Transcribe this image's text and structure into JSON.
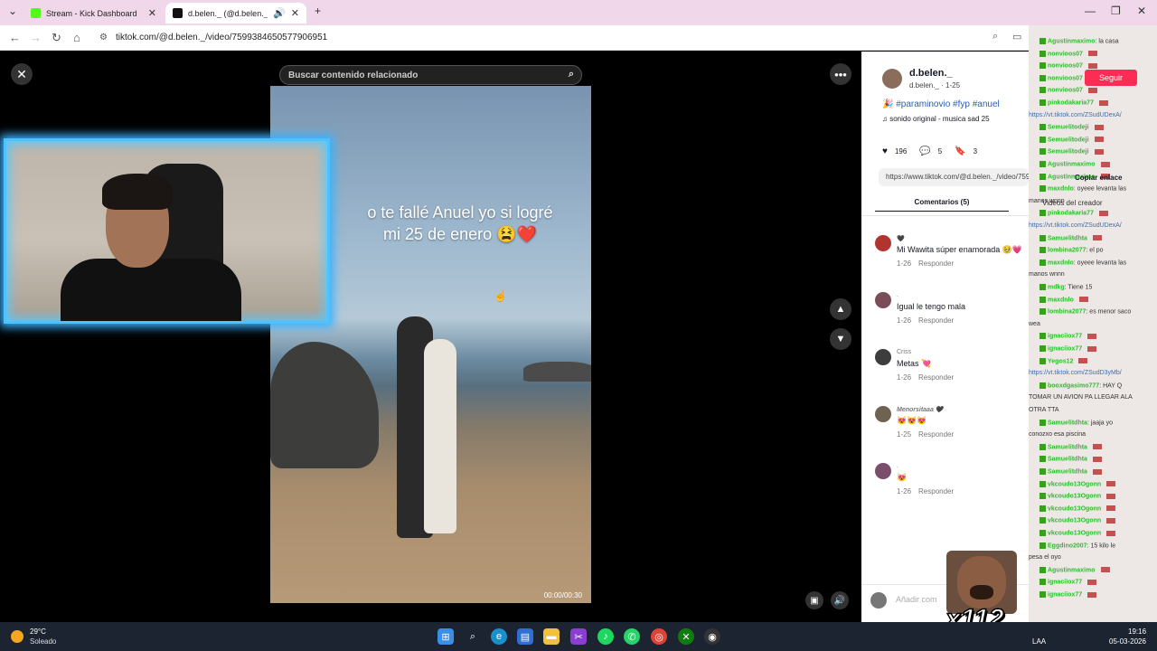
{
  "browser": {
    "tabs": [
      {
        "title": "Stream - Kick Dashboard",
        "favicon_color": "#53fc18"
      },
      {
        "title": "d.belen._ (@d.belen._) | TikT",
        "favicon_color": "#111111"
      }
    ],
    "url": "tiktok.com/@d.belen._/video/7599384650577906951"
  },
  "viewer": {
    "search_placeholder": "Buscar contenido relacionado",
    "caption_line1": "o te fallé Anuel yo si logré",
    "caption_line2": "mi  25 de enero 😫❤️",
    "timestamp": "00:00/00:30"
  },
  "post": {
    "author": "d.belen._",
    "author_sub": "d.belen._ · 1-25",
    "description": "🎉 #paraminovio #fyp #anuel",
    "music": "sonido original - musica sad 25",
    "likes": "196",
    "comments_count": "5",
    "saves": "3",
    "link": "https://www.tiktok.com/@d.belen._/video/759938...",
    "comments_tab": "Comentarios (5)",
    "add_comment_placeholder": "Añadir com"
  },
  "comments": [
    {
      "name": "🖤",
      "text": "Mi Wawita súper enamorada 🥹💗",
      "date": "1-26",
      "reply": "Responder"
    },
    {
      "name": ".",
      "text": "Igual le tengo mala",
      "date": "1-26",
      "reply": "Responder"
    },
    {
      "name": "Criss",
      "text": "Metas 💘",
      "date": "1-26",
      "reply": "Responder"
    },
    {
      "name": "Menorsitaaa 🖤",
      "text": "😻😻😻",
      "date": "1-25",
      "reply": "Responder"
    },
    {
      "name": ".",
      "text": "😻",
      "date": "1-26",
      "reply": "Responder"
    }
  ],
  "overlay": {
    "follow_label": "Seguir",
    "copy_link_label": "Copiar enlace",
    "creator_videos_label": "Videos del creador",
    "emote_count": "x112"
  },
  "chat": [
    {
      "user": "Agustinmaximo",
      "msg": ": la casa"
    },
    {
      "user": "nonvioos07",
      "msg": ""
    },
    {
      "user": "nonvioos07",
      "msg": ""
    },
    {
      "user": "nonvioos07",
      "msg": ""
    },
    {
      "user": "nonvioos07",
      "msg": ""
    },
    {
      "user": "pinkodakaria77",
      "msg": ""
    },
    {
      "user": "",
      "msg": "https://vt.tiktok.com/ZSudUDexA/"
    },
    {
      "user": "Semuelitodeji",
      "msg": ""
    },
    {
      "user": "Semuelitodeji",
      "msg": ""
    },
    {
      "user": "Semuelitodeji",
      "msg": ""
    },
    {
      "user": "Agustinmaximo",
      "msg": ""
    },
    {
      "user": "Agustinmaximo",
      "msg": ""
    },
    {
      "user": "maxdnlo",
      "msg": ": oyeee levanta las"
    },
    {
      "user": "",
      "msg": "manos wnnn"
    },
    {
      "user": "pinkodakaria77",
      "msg": ""
    },
    {
      "user": "",
      "msg": "https://vt.tiktok.com/ZSudUDexA/"
    },
    {
      "user": "Samuelitdhta",
      "msg": ""
    },
    {
      "user": "lombina2077",
      "msg": ": el po"
    },
    {
      "user": "maxdnlo",
      "msg": ": oyeee levanta las"
    },
    {
      "user": "",
      "msg": "manos wnnn"
    },
    {
      "user": "mdkg",
      "msg": ": Tiene 15"
    },
    {
      "user": "maxdnlo",
      "msg": ""
    },
    {
      "user": "lombina2077",
      "msg": ": es menor saco"
    },
    {
      "user": "",
      "msg": "wea"
    },
    {
      "user": "ignaciiox77",
      "msg": ""
    },
    {
      "user": "ignaciiox77",
      "msg": ""
    },
    {
      "user": "Yegos12",
      "msg": ""
    },
    {
      "user": "",
      "msg": "https://vt.tiktok.com/ZSudD3yMb/"
    },
    {
      "user": "booxdgasimo777",
      "msg": ": HAY Q"
    },
    {
      "user": "",
      "msg": "TOMAR UN AVION PA LLEGAR ALA"
    },
    {
      "user": "",
      "msg": "OTRA TTA"
    },
    {
      "user": "Samuelitdhta",
      "msg": ": jaaja yo"
    },
    {
      "user": "",
      "msg": "conozxo esa piscina"
    },
    {
      "user": "Samuelitdhta",
      "msg": ""
    },
    {
      "user": "Samuelitdhta",
      "msg": ""
    },
    {
      "user": "Samuelitdhta",
      "msg": ""
    },
    {
      "user": "vkcoudo13Ogonn",
      "msg": ""
    },
    {
      "user": "vkcoudo13Ogonn",
      "msg": ""
    },
    {
      "user": "vkcoudo13Ogonn",
      "msg": ""
    },
    {
      "user": "vkcoudo13Ogonn",
      "msg": ""
    },
    {
      "user": "vkcoudo13Ogonn",
      "msg": ""
    },
    {
      "user": "Eggdino2007",
      "msg": ": 15 kilo le"
    },
    {
      "user": "",
      "msg": "pesa el oyo"
    },
    {
      "user": "Agustinmaximo",
      "msg": ""
    },
    {
      "user": "ignaciiox77",
      "msg": ""
    },
    {
      "user": "ignaciiox77",
      "msg": ""
    }
  ],
  "taskbar": {
    "temp": "29°C",
    "condition": "Soleado",
    "lang": "LAA",
    "time": "19:16",
    "date": "05-03-2026"
  }
}
